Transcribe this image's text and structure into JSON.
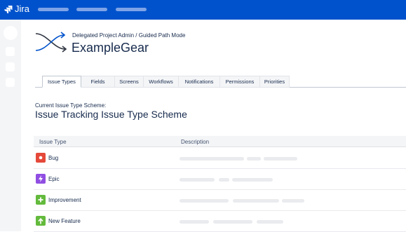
{
  "app": {
    "logo_text": "Jira"
  },
  "topnav": {
    "pills": [
      "",
      "",
      ""
    ]
  },
  "project": {
    "breadcrumb": "Delegated Project Admin / Guided Path Mode",
    "name": "ExampleGear"
  },
  "tabs": [
    {
      "label": "Issue Types",
      "active": true
    },
    {
      "label": "Fields",
      "active": false
    },
    {
      "label": "Screens",
      "active": false
    },
    {
      "label": "Workflows",
      "active": false
    },
    {
      "label": "Notifications",
      "active": false
    },
    {
      "label": "Permissions",
      "active": false
    },
    {
      "label": "Priorities",
      "active": false
    }
  ],
  "scheme": {
    "label": "Current Issue Type Scheme:",
    "name": "Issue Tracking Issue Type Scheme"
  },
  "table": {
    "headers": [
      "Issue Type",
      "Description"
    ],
    "rows": [
      {
        "label": "Bug",
        "icon": "bug-icon",
        "color": "#e5493a"
      },
      {
        "label": "Epic",
        "icon": "lightning-icon",
        "color": "#904ee2"
      },
      {
        "label": "Improvement",
        "icon": "plus-icon",
        "color": "#63ba3c"
      },
      {
        "label": "New Feature",
        "icon": "arrow-up-icon",
        "color": "#63ba3c"
      }
    ]
  },
  "colors": {
    "topbar": "#0052cc",
    "sidebar": "#f4f5f7"
  }
}
